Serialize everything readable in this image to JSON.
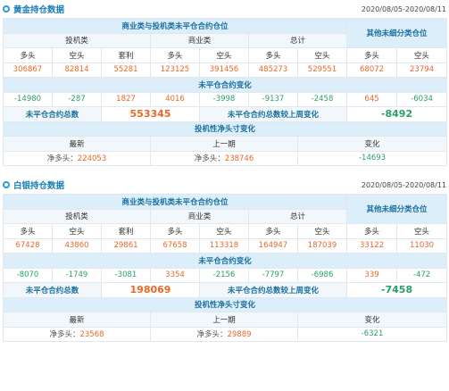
{
  "gold": {
    "title": "黄金持仓数据",
    "date_range": "2020/08/05-2020/08/11",
    "header_top": "商业类与投机类未平仓合约仓位",
    "header_other": "其他未细分类仓位",
    "groups": [
      "投机类",
      "商业类",
      "总计"
    ],
    "cols": [
      "多头",
      "空头",
      "套利",
      "多头",
      "空头",
      "多头",
      "空头",
      "多头",
      "空头"
    ],
    "values": [
      "306867",
      "82814",
      "55281",
      "123125",
      "391456",
      "485273",
      "529551",
      "68072",
      "23794"
    ],
    "change_header": "未平仓合约变化",
    "changes": [
      "-14980",
      "-287",
      "1827",
      "4016",
      "-3998",
      "-9137",
      "-2458",
      "645",
      "-6034"
    ],
    "oi_total_label": "未平仓合约总数",
    "oi_total": "553345",
    "oi_change_label": "未平仓合约总数较上周变化",
    "oi_change": "-8492",
    "spec_header": "投机性净头寸变化",
    "latest_label": "最新",
    "prev_label": "上一期",
    "change_label": "变化",
    "net_label": "净多头：",
    "latest_value": "224053",
    "prev_value": "238746",
    "net_change": "-14693"
  },
  "silver": {
    "title": "白银持仓数据",
    "date_range": "2020/08/05-2020/08/11",
    "header_top": "商业类与投机类未平仓合约仓位",
    "header_other": "其他未细分类仓位",
    "groups": [
      "投机类",
      "商业类",
      "总计"
    ],
    "cols": [
      "多头",
      "空头",
      "套利",
      "多头",
      "空头",
      "多头",
      "空头",
      "多头",
      "空头"
    ],
    "values": [
      "67428",
      "43860",
      "29861",
      "67658",
      "113318",
      "164947",
      "187039",
      "33122",
      "11030"
    ],
    "change_header": "未平仓合约变化",
    "changes": [
      "-8070",
      "-1749",
      "-3081",
      "3354",
      "-2156",
      "-7797",
      "-6986",
      "339",
      "-472"
    ],
    "oi_total_label": "未平仓合约总数",
    "oi_total": "198069",
    "oi_change_label": "未平仓合约总数较上周变化",
    "oi_change": "-7458",
    "spec_header": "投机性净头寸变化",
    "latest_label": "最新",
    "prev_label": "上一期",
    "change_label": "变化",
    "net_label": "净多头：",
    "latest_value": "23568",
    "prev_value": "29889",
    "net_change": "-6321"
  },
  "colors": {
    "accent": "#1a7fb5",
    "header_bg": "#dbeefa",
    "red": "#e8682a",
    "green": "#29a06a"
  }
}
